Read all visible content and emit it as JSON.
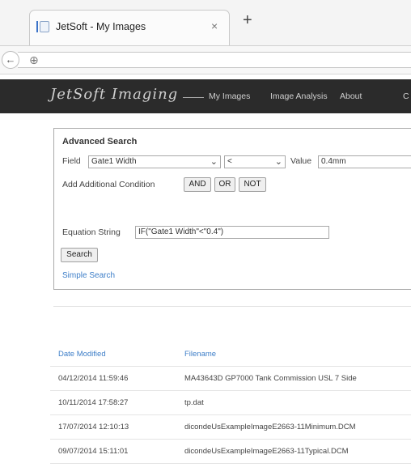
{
  "browser": {
    "tab_title": "JetSoft - My Images",
    "tab_close": "×",
    "new_tab": "+",
    "back": "←",
    "globe": "⊕"
  },
  "nav": {
    "brand": "JetSoft Imaging",
    "items": [
      "My Images",
      "Image Analysis",
      "About",
      "C"
    ]
  },
  "search": {
    "title": "Advanced Search",
    "field_label": "Field",
    "field_value": "Gate1 Width",
    "operator_value": "<",
    "value_label": "Value",
    "value_input": "0.4mm",
    "add_condition_label": "Add Additional Condition",
    "and_label": "AND",
    "or_label": "OR",
    "not_label": "NOT",
    "equation_label": "Equation String",
    "equation_value": "IF(\"Gate1 Width\"<\"0.4\")",
    "search_button": "Search",
    "simple_search_link": "Simple Search"
  },
  "table": {
    "headers": [
      "Date Modified",
      "Filename"
    ],
    "rows": [
      [
        "04/12/2014 11:59:46",
        "MA43643D GP7000 Tank Commission USL 7 Side"
      ],
      [
        "10/11/2014 17:58:27",
        "tp.dat"
      ],
      [
        "17/07/2014 12:10:13",
        "dicondeUsExampleImageE2663-11Minimum.DCM"
      ],
      [
        "09/07/2014 15:11:01",
        "dicondeUsExampleImageE2663-11Typical.DCM"
      ]
    ]
  }
}
